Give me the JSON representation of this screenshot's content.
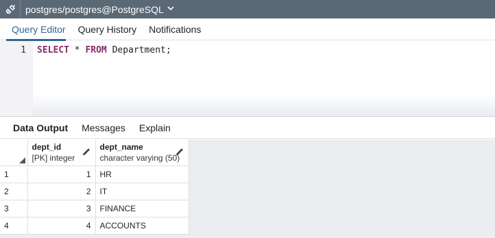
{
  "connection": {
    "title": "postgres/postgres@PostgreSQL",
    "icon": "connection-plug-icon",
    "dropdown_icon": "chevron-down-icon"
  },
  "editor_tabs": [
    "Query Editor",
    "Query History",
    "Notifications"
  ],
  "editor": {
    "line_number": "1",
    "keyword_select": "SELECT",
    "star": " * ",
    "keyword_from": "FROM",
    "rest": " Department;"
  },
  "output_tabs": [
    "Data Output",
    "Messages",
    "Explain"
  ],
  "grid": {
    "columns": [
      {
        "name": "dept_id",
        "type": "[PK] integer"
      },
      {
        "name": "dept_name",
        "type": "character varying (50)"
      }
    ],
    "rows": [
      {
        "num": "1",
        "dept_id": "1",
        "dept_name": "HR"
      },
      {
        "num": "2",
        "dept_id": "2",
        "dept_name": "IT"
      },
      {
        "num": "3",
        "dept_id": "3",
        "dept_name": "FINANCE"
      },
      {
        "num": "4",
        "dept_id": "4",
        "dept_name": "ACCOUNTS"
      }
    ]
  },
  "colors": {
    "toolbar": "#5b6875",
    "active_tab": "#326690",
    "keyword": "#8a2a6e"
  }
}
